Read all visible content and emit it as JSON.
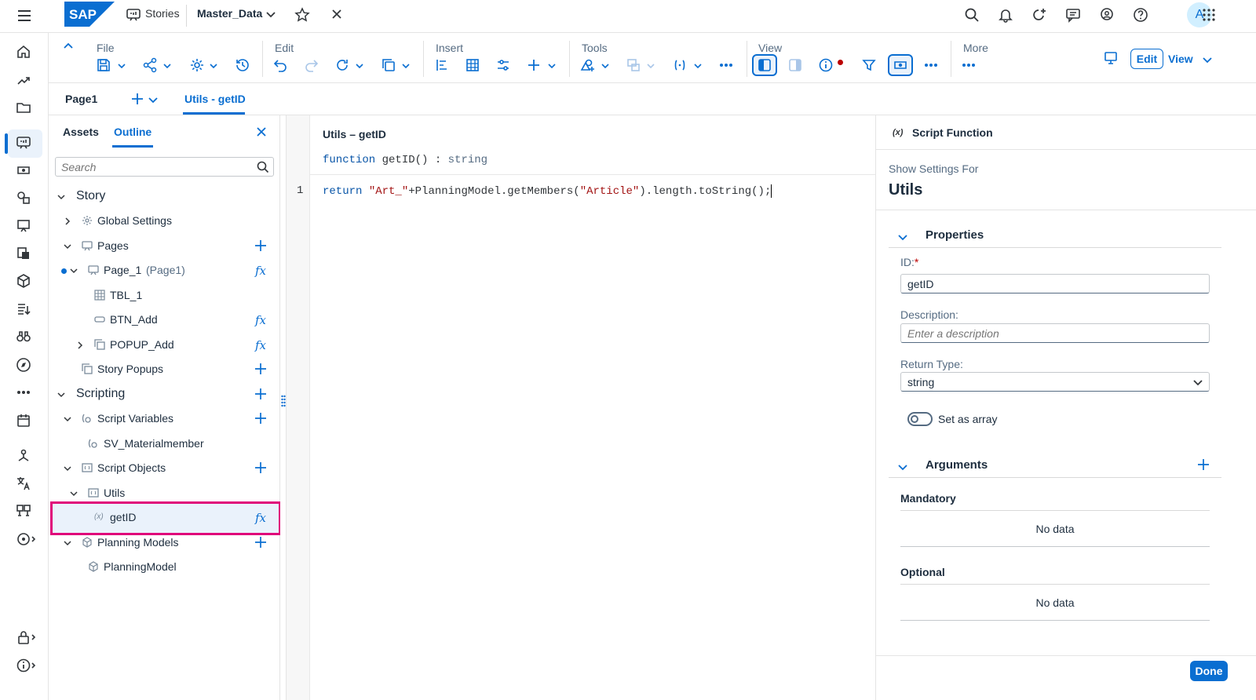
{
  "shell": {
    "logo": "SAP",
    "app_label": "Stories",
    "file_name": "Master_Data",
    "avatar_initial": "A"
  },
  "toolbar": {
    "groups": [
      "File",
      "Edit",
      "Insert",
      "Tools",
      "View",
      "More"
    ],
    "edit_label": "Edit",
    "view_label": "View"
  },
  "tabs": {
    "page": "Page1",
    "active": "Utils - getID"
  },
  "outline": {
    "tab_assets": "Assets",
    "tab_outline": "Outline",
    "search_placeholder": "Search",
    "items": [
      {
        "label": "Story"
      },
      {
        "label": "Global Settings"
      },
      {
        "label": "Pages"
      },
      {
        "label": "Page_1",
        "sub": "(Page1)"
      },
      {
        "label": "TBL_1"
      },
      {
        "label": "BTN_Add"
      },
      {
        "label": "POPUP_Add"
      },
      {
        "label": "Story Popups"
      },
      {
        "label": "Scripting"
      },
      {
        "label": "Script Variables"
      },
      {
        "label": "SV_Materialmember"
      },
      {
        "label": "Script Objects"
      },
      {
        "label": "Utils"
      },
      {
        "label": "getID"
      },
      {
        "label": "Planning Models"
      },
      {
        "label": "PlanningModel"
      }
    ]
  },
  "editor": {
    "title": "Utils – getID",
    "sig_keyword": "function",
    "sig_name": "getID()",
    "sig_colon": " : ",
    "sig_type": "string",
    "line_number": "1",
    "code_keyword": "return",
    "code_str1": "\"Art_\"",
    "code_mid": "+PlanningModel.getMembers(",
    "code_str2": "\"Article\"",
    "code_end": ").length.toString();"
  },
  "properties_panel": {
    "header": "Script Function",
    "show_settings_for": "Show Settings For",
    "object_name": "Utils",
    "section_properties": "Properties",
    "id_label": "ID:",
    "id_required": "*",
    "id_value": "getID",
    "description_label": "Description:",
    "description_placeholder": "Enter a description",
    "return_type_label": "Return Type:",
    "return_type_value": "string",
    "set_as_array": "Set as array",
    "section_arguments": "Arguments",
    "mandatory": "Mandatory",
    "mandatory_empty": "No data",
    "optional": "Optional",
    "optional_empty": "No data",
    "done": "Done"
  },
  "colors": {
    "accent": "#0a6ed1",
    "highlight_border": "#e0067a",
    "required": "#bb0000"
  }
}
